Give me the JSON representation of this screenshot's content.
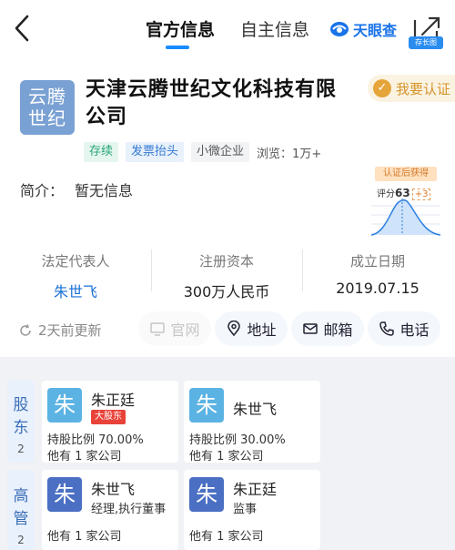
{
  "header": {
    "tabs": [
      {
        "label": "官方信息",
        "active": true
      },
      {
        "label": "自主信息",
        "active": false
      }
    ],
    "brand": "天眼查",
    "share_badge": "存长图",
    "accent": "#1a8cff"
  },
  "company": {
    "logo_text": "云腾\n世纪",
    "name": "天津云腾世纪文化科技有限公司",
    "certify_label": "我要认证",
    "tags": [
      "存续",
      "发票抬头",
      "小微企业"
    ],
    "views": "浏览：1万+",
    "intro_label": "简介：",
    "intro_value": "暂无信息",
    "score_head": "认证后获得",
    "score_prefix": "评分",
    "score_value": "63",
    "score_plus": "+3",
    "legal_rep_label": "法定代表人",
    "legal_rep_value": "朱世飞",
    "capital_label": "注册资本",
    "capital_value": "300万人民币",
    "date_label": "成立日期",
    "date_value": "2019.07.15",
    "updated": "2天前更新",
    "actions": {
      "website": "官网",
      "address": "地址",
      "email": "邮箱",
      "phone": "电话"
    }
  },
  "shareholders": {
    "label": "股东",
    "count": "2",
    "items": [
      {
        "avatar": "朱",
        "name": "朱正廷",
        "badge": "大股东",
        "ratio": "持股比例  70.00%",
        "other": "他有 1 家公司"
      },
      {
        "avatar": "朱",
        "name": "朱世飞",
        "ratio": "持股比例  30.00%",
        "other": "他有 1 家公司"
      }
    ]
  },
  "executives": {
    "label": "高管",
    "count": "2",
    "items": [
      {
        "avatar": "朱",
        "name": "朱世飞",
        "position": "经理,执行董事",
        "other": "他有 1 家公司"
      },
      {
        "avatar": "朱",
        "name": "朱正廷",
        "position": "监事",
        "other": "他有 1 家公司"
      }
    ]
  }
}
